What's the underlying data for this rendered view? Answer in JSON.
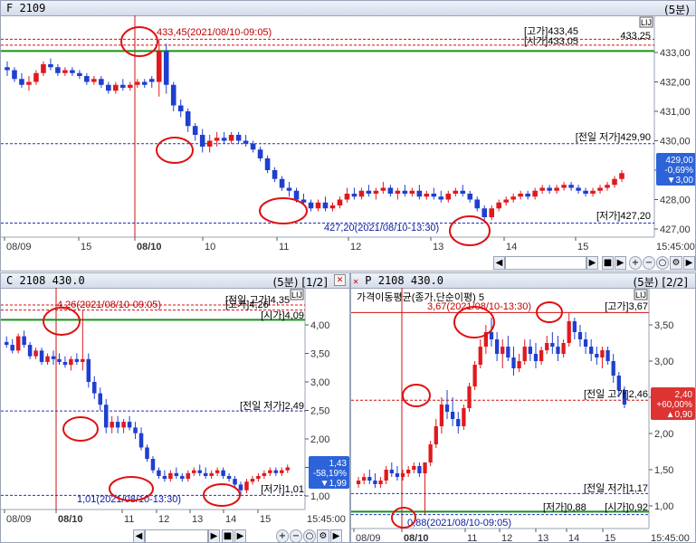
{
  "colors": {
    "up": "#e0191e",
    "down": "#1e3fd0",
    "accent_green": "#189018",
    "ma": "#000000",
    "red_dash": "#d01010",
    "blue_dash": "#2030c0",
    "annot_red": "#c00000",
    "annot_blue": "#1020a0",
    "down_badge": "#2d63d8",
    "up_badge": "#dd3333"
  },
  "panel1": {
    "title": "F 2109",
    "period": "(5분)",
    "ll": "LIJ",
    "price_axis": [
      "433,00",
      "432,00",
      "431,00",
      "430,00",
      "429,00",
      "428,00",
      "427,00"
    ],
    "high_label": "[고가]433,45",
    "open_label": "[시가]433,05",
    "high2_label": "433,25",
    "hi_annot": "433,45(2021/08/10-09:05)",
    "prev_low": "[전일 저가]429,90",
    "low_label": "[저가]427,20",
    "lo_annot": "427,20(2021/08/10-13:30)",
    "badge": [
      "429,00",
      "-0,69%",
      "▼3,00"
    ],
    "time_axis": [
      "08/09",
      "15",
      "08/10",
      "10",
      "11",
      "12",
      "13",
      "14",
      "15",
      "15:45:00"
    ],
    "candles": [
      [
        432.5,
        432.7,
        432.2,
        432.4
      ],
      [
        432.4,
        432.5,
        432.0,
        432.1
      ],
      [
        432.1,
        432.3,
        431.8,
        431.9
      ],
      [
        431.9,
        432.2,
        431.7,
        432.0
      ],
      [
        432.0,
        432.4,
        431.9,
        432.3
      ],
      [
        432.3,
        432.7,
        432.2,
        432.6
      ],
      [
        432.6,
        432.8,
        432.4,
        432.5
      ],
      [
        432.5,
        432.6,
        432.2,
        432.3
      ],
      [
        432.3,
        432.5,
        432.2,
        432.4
      ],
      [
        432.4,
        432.5,
        432.2,
        432.3
      ],
      [
        432.3,
        432.4,
        432.1,
        432.2
      ],
      [
        432.2,
        432.3,
        431.9,
        432.0
      ],
      [
        432.0,
        432.2,
        431.9,
        432.1
      ],
      [
        432.1,
        432.2,
        431.8,
        431.9
      ],
      [
        431.9,
        432.0,
        431.6,
        431.7
      ],
      [
        431.7,
        432.0,
        431.6,
        431.9
      ],
      [
        431.9,
        432.1,
        431.7,
        431.8
      ],
      [
        431.8,
        432.0,
        431.7,
        431.9
      ],
      [
        431.9,
        432.1,
        431.8,
        432.0
      ],
      [
        432.0,
        432.1,
        431.8,
        431.9
      ],
      [
        432.1,
        432.2,
        431.8,
        432.0
      ],
      [
        432.0,
        433.45,
        431.5,
        433.05
      ],
      [
        433.05,
        433.3,
        431.6,
        431.9
      ],
      [
        431.9,
        432.0,
        431.0,
        431.2
      ],
      [
        431.2,
        431.4,
        430.8,
        431.0
      ],
      [
        431.0,
        431.1,
        430.3,
        430.5
      ],
      [
        430.5,
        430.6,
        430.0,
        430.2
      ],
      [
        430.2,
        430.4,
        429.6,
        429.8
      ],
      [
        429.8,
        430.2,
        429.6,
        430.0
      ],
      [
        430.0,
        430.3,
        429.8,
        430.1
      ],
      [
        430.1,
        430.3,
        429.9,
        430.0
      ],
      [
        430.0,
        430.3,
        429.9,
        430.2
      ],
      [
        430.2,
        430.3,
        429.9,
        430.0
      ],
      [
        430.0,
        430.2,
        429.8,
        429.9
      ],
      [
        429.9,
        430.0,
        429.6,
        429.7
      ],
      [
        429.7,
        429.8,
        429.3,
        429.4
      ],
      [
        429.4,
        429.5,
        428.9,
        429.0
      ],
      [
        429.0,
        429.1,
        428.6,
        428.7
      ],
      [
        428.7,
        428.8,
        428.3,
        428.4
      ],
      [
        428.4,
        428.6,
        428.1,
        428.3
      ],
      [
        428.3,
        428.4,
        427.9,
        428.0
      ],
      [
        428.0,
        428.2,
        427.8,
        427.9
      ],
      [
        427.9,
        428.0,
        427.6,
        427.7
      ],
      [
        427.7,
        428.0,
        427.6,
        427.9
      ],
      [
        427.9,
        428.1,
        427.6,
        427.7
      ],
      [
        427.7,
        427.9,
        427.6,
        427.8
      ],
      [
        427.8,
        428.1,
        427.7,
        428.0
      ],
      [
        428.0,
        428.4,
        427.9,
        428.2
      ],
      [
        428.2,
        428.4,
        428.0,
        428.1
      ],
      [
        428.1,
        428.4,
        428.0,
        428.3
      ],
      [
        428.3,
        428.5,
        428.1,
        428.2
      ],
      [
        428.2,
        428.4,
        428.0,
        428.3
      ],
      [
        428.3,
        428.6,
        428.2,
        428.4
      ],
      [
        428.4,
        428.5,
        428.1,
        428.2
      ],
      [
        428.2,
        428.4,
        428.0,
        428.3
      ],
      [
        428.3,
        428.5,
        428.1,
        428.2
      ],
      [
        428.2,
        428.4,
        428.1,
        428.3
      ],
      [
        428.3,
        428.5,
        428.0,
        428.1
      ],
      [
        428.1,
        428.3,
        428.0,
        428.2
      ],
      [
        428.2,
        428.4,
        428.0,
        428.1
      ],
      [
        428.1,
        428.3,
        427.9,
        428.0
      ],
      [
        428.0,
        428.3,
        427.9,
        428.2
      ],
      [
        428.2,
        428.4,
        428.1,
        428.3
      ],
      [
        428.3,
        428.5,
        428.1,
        428.2
      ],
      [
        428.2,
        428.3,
        427.9,
        428.0
      ],
      [
        428.0,
        428.1,
        427.6,
        427.7
      ],
      [
        427.7,
        427.8,
        427.2,
        427.4
      ],
      [
        427.4,
        427.8,
        427.3,
        427.7
      ],
      [
        427.7,
        428.0,
        427.6,
        427.9
      ],
      [
        427.9,
        428.1,
        427.8,
        428.0
      ],
      [
        428.0,
        428.2,
        427.9,
        428.1
      ],
      [
        428.1,
        428.3,
        428.0,
        428.2
      ],
      [
        428.2,
        428.3,
        428.0,
        428.1
      ],
      [
        428.1,
        428.4,
        428.0,
        428.3
      ],
      [
        428.3,
        428.5,
        428.2,
        428.4
      ],
      [
        428.4,
        428.5,
        428.2,
        428.3
      ],
      [
        428.3,
        428.5,
        428.2,
        428.4
      ],
      [
        428.4,
        428.6,
        428.3,
        428.5
      ],
      [
        428.5,
        428.6,
        428.3,
        428.4
      ],
      [
        428.4,
        428.5,
        428.2,
        428.3
      ],
      [
        428.3,
        428.4,
        428.1,
        428.2
      ],
      [
        428.2,
        428.4,
        428.1,
        428.3
      ],
      [
        428.3,
        428.5,
        428.2,
        428.4
      ],
      [
        428.4,
        428.6,
        428.3,
        428.5
      ],
      [
        428.5,
        428.8,
        428.4,
        428.7
      ],
      [
        428.7,
        429.0,
        428.6,
        428.9
      ]
    ]
  },
  "panel2": {
    "title": "C 2108 430.0",
    "period": "(5분)",
    "page": "[1/2]",
    "ll": "LIJ",
    "price_axis": [
      "4,00",
      "3,50",
      "3,00",
      "2,50",
      "2,00",
      "1,50",
      "1,00"
    ],
    "hi_annot": "4,26(2021/08/10-09:05)",
    "high_label": "[고가]4,26",
    "prev_high": "[전일 고가]4,35",
    "open_label": "[시가]4,09",
    "prev_low": "[전일 저가]2,49",
    "low_label": "[저가]1,01",
    "lo_annot": "1,01(2021/08/10-13:30)",
    "badge": [
      "1,43",
      "-58,19%",
      "▼1,99"
    ],
    "time_axis": [
      "08/09",
      "08/10",
      "11",
      "12",
      "13",
      "14",
      "15",
      "15:45:00"
    ],
    "candles": [
      [
        3.7,
        3.8,
        3.6,
        3.65
      ],
      [
        3.65,
        3.75,
        3.5,
        3.55
      ],
      [
        3.55,
        3.85,
        3.5,
        3.8
      ],
      [
        3.8,
        3.9,
        3.6,
        3.65
      ],
      [
        3.65,
        3.7,
        3.4,
        3.45
      ],
      [
        3.45,
        3.6,
        3.4,
        3.55
      ],
      [
        3.55,
        3.6,
        3.3,
        3.35
      ],
      [
        3.35,
        3.5,
        3.3,
        3.45
      ],
      [
        3.45,
        3.55,
        3.3,
        3.4
      ],
      [
        3.4,
        3.5,
        3.3,
        3.35
      ],
      [
        3.35,
        3.45,
        3.25,
        3.3
      ],
      [
        3.3,
        3.45,
        3.2,
        3.4
      ],
      [
        3.4,
        3.5,
        3.3,
        3.35
      ],
      [
        3.35,
        4.26,
        3.2,
        3.4
      ],
      [
        3.4,
        3.5,
        2.9,
        3.0
      ],
      [
        3.0,
        3.1,
        2.7,
        2.8
      ],
      [
        2.8,
        2.9,
        2.5,
        2.6
      ],
      [
        2.6,
        2.7,
        2.1,
        2.2
      ],
      [
        2.2,
        2.4,
        2.1,
        2.3
      ],
      [
        2.3,
        2.4,
        2.1,
        2.2
      ],
      [
        2.2,
        2.35,
        2.1,
        2.3
      ],
      [
        2.3,
        2.4,
        2.15,
        2.2
      ],
      [
        2.2,
        2.3,
        2.0,
        2.1
      ],
      [
        2.1,
        2.2,
        1.8,
        1.85
      ],
      [
        1.85,
        1.9,
        1.6,
        1.65
      ],
      [
        1.65,
        1.7,
        1.4,
        1.45
      ],
      [
        1.45,
        1.5,
        1.3,
        1.35
      ],
      [
        1.35,
        1.45,
        1.25,
        1.3
      ],
      [
        1.3,
        1.45,
        1.25,
        1.4
      ],
      [
        1.4,
        1.5,
        1.3,
        1.35
      ],
      [
        1.35,
        1.4,
        1.25,
        1.3
      ],
      [
        1.3,
        1.45,
        1.25,
        1.4
      ],
      [
        1.4,
        1.5,
        1.35,
        1.45
      ],
      [
        1.45,
        1.55,
        1.35,
        1.4
      ],
      [
        1.4,
        1.5,
        1.3,
        1.35
      ],
      [
        1.35,
        1.45,
        1.3,
        1.4
      ],
      [
        1.4,
        1.5,
        1.35,
        1.45
      ],
      [
        1.45,
        1.5,
        1.3,
        1.35
      ],
      [
        1.35,
        1.4,
        1.25,
        1.3
      ],
      [
        1.3,
        1.35,
        1.15,
        1.2
      ],
      [
        1.2,
        1.25,
        1.01,
        1.1
      ],
      [
        1.1,
        1.3,
        1.05,
        1.25
      ],
      [
        1.25,
        1.35,
        1.2,
        1.3
      ],
      [
        1.3,
        1.4,
        1.25,
        1.35
      ],
      [
        1.35,
        1.45,
        1.3,
        1.4
      ],
      [
        1.4,
        1.5,
        1.35,
        1.45
      ],
      [
        1.45,
        1.5,
        1.35,
        1.4
      ],
      [
        1.4,
        1.5,
        1.35,
        1.45
      ],
      [
        1.45,
        1.55,
        1.4,
        1.5
      ]
    ]
  },
  "panel3": {
    "title": "P 2108 430.0",
    "period": "(5분)",
    "page": "[2/2]",
    "ll": "LIJ",
    "ma_label": "가격이동평균(종가,단순이평) 5",
    "price_axis": [
      "3,50",
      "3,00",
      "2,50",
      "2,00",
      "1,50",
      "1,00"
    ],
    "hi_annot": "3,67(2021/08/10-13:30)",
    "high_label": "[고가]3,67",
    "prev_high": "[전일 고가]2,46",
    "prev_low": "[전일 저가]1,17",
    "low_label": "[저가]0,88",
    "open_label": "[시가]0,92",
    "lo_annot": "0,88(2021/08/10-09:05)",
    "badge": [
      "2,40",
      "+60,00%",
      "▲0,90"
    ],
    "time_axis": [
      "08/09",
      "08/10",
      "11",
      "12",
      "13",
      "14",
      "15",
      "15:45:00"
    ],
    "candles": [
      [
        1.3,
        1.4,
        1.25,
        1.35
      ],
      [
        1.35,
        1.45,
        1.3,
        1.4
      ],
      [
        1.4,
        1.5,
        1.3,
        1.35
      ],
      [
        1.35,
        1.45,
        1.25,
        1.3
      ],
      [
        1.3,
        1.4,
        1.25,
        1.35
      ],
      [
        1.35,
        1.55,
        1.3,
        1.5
      ],
      [
        1.5,
        1.6,
        1.4,
        1.45
      ],
      [
        1.45,
        1.55,
        1.35,
        1.4
      ],
      [
        1.4,
        1.5,
        1.35,
        1.45
      ],
      [
        1.45,
        1.55,
        1.4,
        1.5
      ],
      [
        1.5,
        1.6,
        1.45,
        1.55
      ],
      [
        1.55,
        1.6,
        1.4,
        1.45
      ],
      [
        1.45,
        1.5,
        0.88,
        1.6
      ],
      [
        1.6,
        1.9,
        1.55,
        1.85
      ],
      [
        1.85,
        2.2,
        1.8,
        2.1
      ],
      [
        2.1,
        2.5,
        2.0,
        2.4
      ],
      [
        2.4,
        2.6,
        2.2,
        2.3
      ],
      [
        2.3,
        2.5,
        2.1,
        2.2
      ],
      [
        2.2,
        2.3,
        2.0,
        2.1
      ],
      [
        2.1,
        2.4,
        2.05,
        2.35
      ],
      [
        2.35,
        2.7,
        2.3,
        2.65
      ],
      [
        2.65,
        3.0,
        2.6,
        2.95
      ],
      [
        2.95,
        3.3,
        2.9,
        3.2
      ],
      [
        3.2,
        3.5,
        3.1,
        3.4
      ],
      [
        3.4,
        3.6,
        3.2,
        3.3
      ],
      [
        3.3,
        3.4,
        3.0,
        3.1
      ],
      [
        3.1,
        3.3,
        2.9,
        3.2
      ],
      [
        3.2,
        3.35,
        3.0,
        3.05
      ],
      [
        3.05,
        3.2,
        2.8,
        2.9
      ],
      [
        2.9,
        3.1,
        2.85,
        3.0
      ],
      [
        3.0,
        3.3,
        2.95,
        3.2
      ],
      [
        3.2,
        3.3,
        3.0,
        3.1
      ],
      [
        3.1,
        3.25,
        2.9,
        3.0
      ],
      [
        3.0,
        3.2,
        2.95,
        3.15
      ],
      [
        3.15,
        3.35,
        3.1,
        3.25
      ],
      [
        3.25,
        3.4,
        3.1,
        3.2
      ],
      [
        3.2,
        3.35,
        3.0,
        3.1
      ],
      [
        3.1,
        3.3,
        3.05,
        3.25
      ],
      [
        3.25,
        3.67,
        3.2,
        3.55
      ],
      [
        3.55,
        3.6,
        3.3,
        3.4
      ],
      [
        3.4,
        3.5,
        3.2,
        3.3
      ],
      [
        3.3,
        3.4,
        3.1,
        3.2
      ],
      [
        3.2,
        3.3,
        3.0,
        3.1
      ],
      [
        3.1,
        3.2,
        2.95,
        3.05
      ],
      [
        3.05,
        3.2,
        2.9,
        3.15
      ],
      [
        3.15,
        3.2,
        2.95,
        3.0
      ],
      [
        3.0,
        3.1,
        2.7,
        2.8
      ],
      [
        2.8,
        2.85,
        2.5,
        2.6
      ],
      [
        2.6,
        2.65,
        2.35,
        2.4
      ]
    ]
  }
}
